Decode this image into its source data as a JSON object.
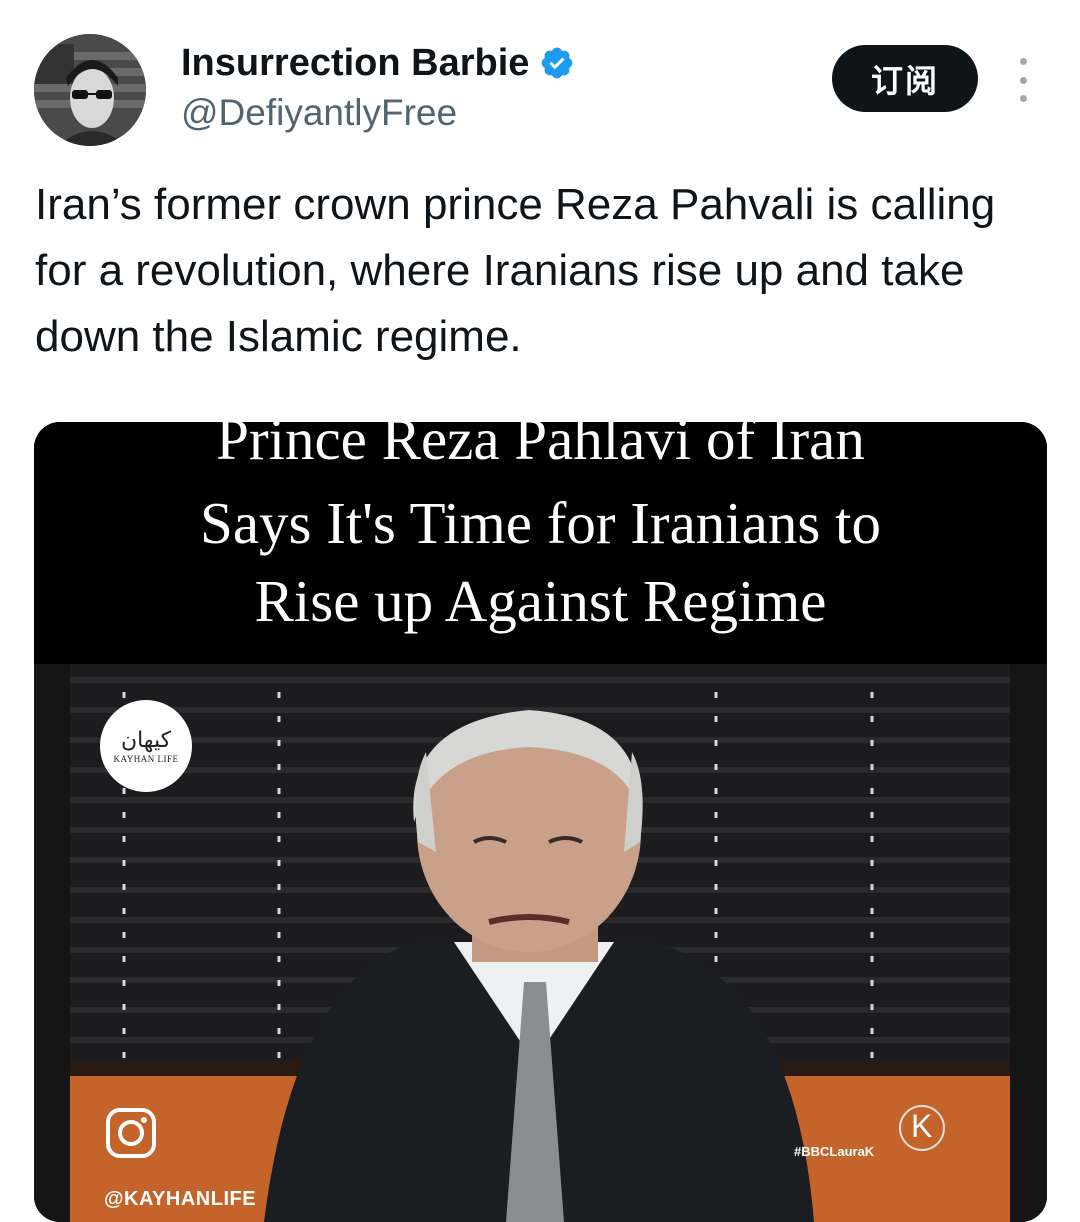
{
  "author": {
    "name": "Insurrection Barbie",
    "handle": "@DefiyantlyFree",
    "verified": true
  },
  "subscribe_label": "订阅",
  "tweet_text": "Iran’s former crown prince Reza Pahvali is calling for a revolution, where Iranians rise up and take down the Islamic regime.",
  "media": {
    "caption_line1": "Prince Reza Pahlavi of Iran",
    "caption_line2": "Says It's Time for Iranians to",
    "caption_line3": "Rise up Against Regime",
    "badge_persian": "کیهان",
    "badge_latin": "KAYHAN LIFE",
    "instagram_handle": "@KAYHANLIFE",
    "bbc_tag": "#BBCLauraK",
    "k_logo": "K"
  },
  "colors": {
    "verified": "#1d9bf0",
    "button_bg": "#0f1419",
    "handle_gray": "#536471"
  },
  "icons": {
    "verified": "verified-badge-icon",
    "more": "more-options-icon",
    "instagram": "instagram-icon"
  }
}
